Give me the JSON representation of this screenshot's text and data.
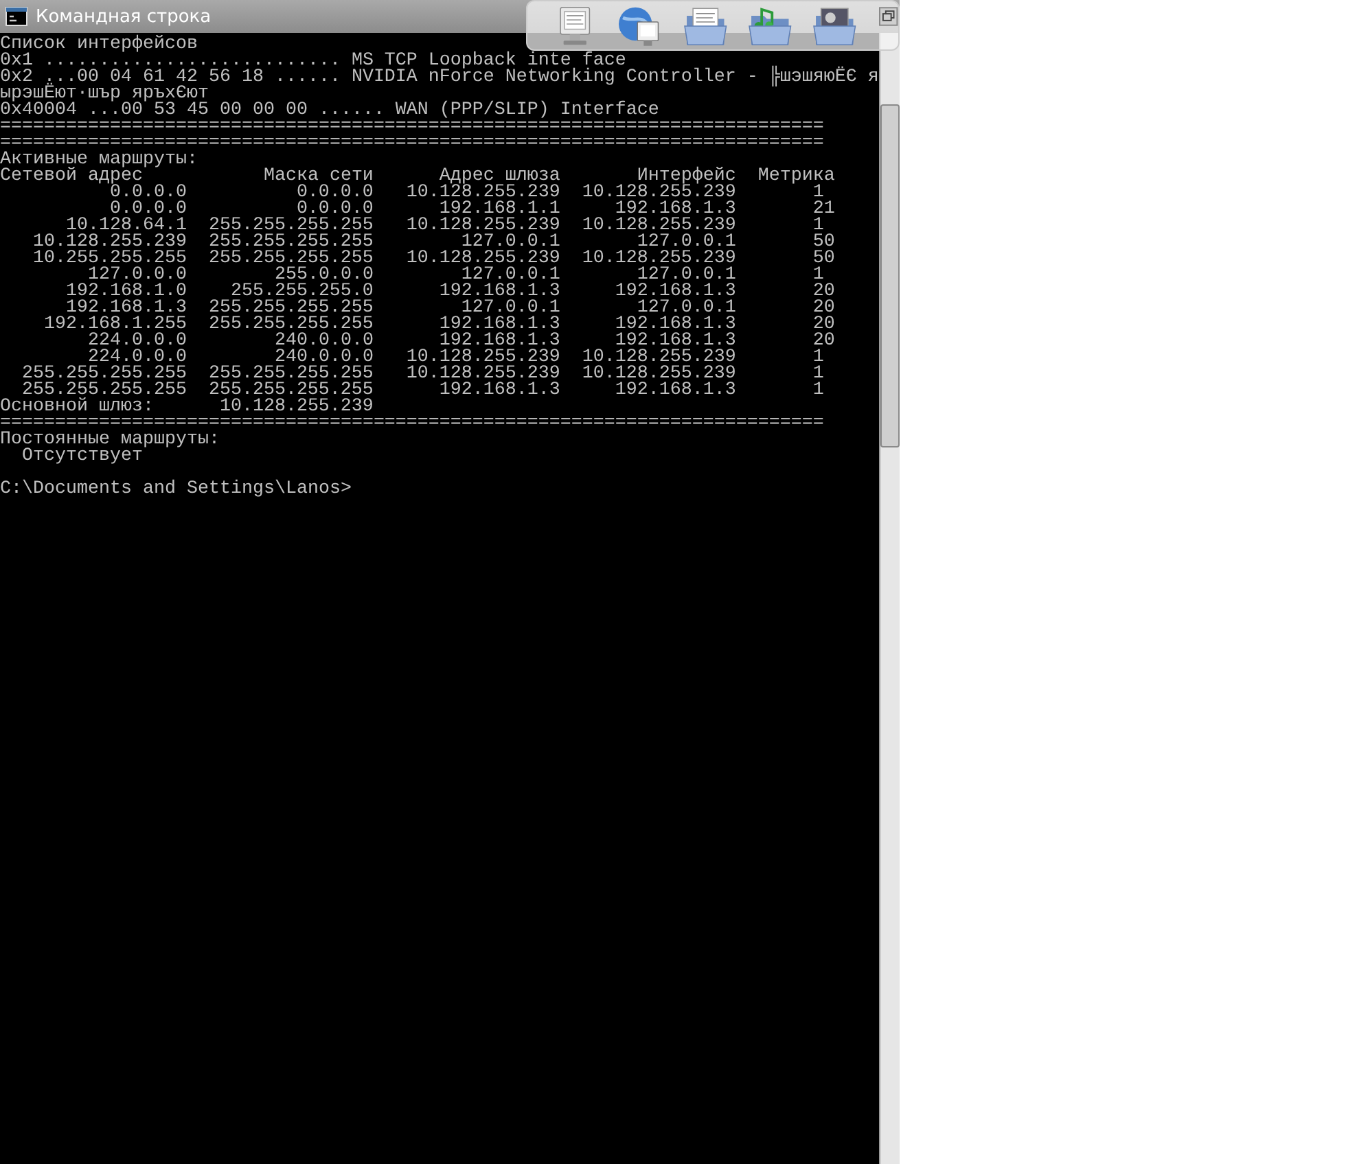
{
  "window": {
    "title": "Командная строка"
  },
  "console": [
    {
      "kind": "text",
      "text": "Список интерфейсов"
    },
    {
      "kind": "text",
      "text": "0x1 ........................... MS TCP Loopback inte face"
    },
    {
      "kind": "text",
      "text": "0x2 ...00 04 61 42 56 18 ...... NVIDIA nForce Networking Controller - ╠шэшяюЁЄ я"
    },
    {
      "kind": "text",
      "text": "ырэшЁют·шър яръхЄют"
    },
    {
      "kind": "text",
      "text": "0x40004 ...00 53 45 00 00 00 ...... WAN (PPP/SLIP) Interface"
    },
    {
      "kind": "text",
      "text": "==========================================================================="
    },
    {
      "kind": "text",
      "text": "==========================================================================="
    },
    {
      "kind": "text",
      "text": "Активные маршруты:"
    },
    {
      "kind": "header",
      "cells": [
        "Сетевой адрес",
        "Маска сети",
        "Адрес шлюза",
        "Интерфейс",
        "Метрика"
      ]
    },
    {
      "kind": "route",
      "cells": [
        "0.0.0.0",
        "0.0.0.0",
        "10.128.255.239",
        "10.128.255.239",
        "1"
      ]
    },
    {
      "kind": "route",
      "cells": [
        "0.0.0.0",
        "0.0.0.0",
        "192.168.1.1",
        "192.168.1.3",
        "21"
      ]
    },
    {
      "kind": "route",
      "cells": [
        "10.128.64.1",
        "255.255.255.255",
        "10.128.255.239",
        "10.128.255.239",
        "1"
      ]
    },
    {
      "kind": "route",
      "cells": [
        "10.128.255.239",
        "255.255.255.255",
        "127.0.0.1",
        "127.0.0.1",
        "50"
      ]
    },
    {
      "kind": "route",
      "cells": [
        "10.255.255.255",
        "255.255.255.255",
        "10.128.255.239",
        "10.128.255.239",
        "50"
      ]
    },
    {
      "kind": "route",
      "cells": [
        "127.0.0.0",
        "255.0.0.0",
        "127.0.0.1",
        "127.0.0.1",
        "1"
      ]
    },
    {
      "kind": "route",
      "cells": [
        "192.168.1.0",
        "255.255.255.0",
        "192.168.1.3",
        "192.168.1.3",
        "20"
      ]
    },
    {
      "kind": "route",
      "cells": [
        "192.168.1.3",
        "255.255.255.255",
        "127.0.0.1",
        "127.0.0.1",
        "20"
      ]
    },
    {
      "kind": "route",
      "cells": [
        "192.168.1.255",
        "255.255.255.255",
        "192.168.1.3",
        "192.168.1.3",
        "20"
      ]
    },
    {
      "kind": "route",
      "cells": [
        "224.0.0.0",
        "240.0.0.0",
        "192.168.1.3",
        "192.168.1.3",
        "20"
      ]
    },
    {
      "kind": "route",
      "cells": [
        "224.0.0.0",
        "240.0.0.0",
        "10.128.255.239",
        "10.128.255.239",
        "1"
      ]
    },
    {
      "kind": "route",
      "cells": [
        "255.255.255.255",
        "255.255.255.255",
        "10.128.255.239",
        "10.128.255.239",
        "1"
      ]
    },
    {
      "kind": "route",
      "cells": [
        "255.255.255.255",
        "255.255.255.255",
        "192.168.1.3",
        "192.168.1.3",
        "1"
      ]
    },
    {
      "kind": "gateway",
      "label": "Основной шлюз:",
      "value": "10.128.255.239"
    },
    {
      "kind": "text",
      "text": "==========================================================================="
    },
    {
      "kind": "text",
      "text": "Постоянные маршруты:"
    },
    {
      "kind": "text",
      "text": "  Отсутствует"
    },
    {
      "kind": "blank"
    },
    {
      "kind": "text",
      "text": "C:\\Documents and Settings\\Lanos>"
    }
  ]
}
